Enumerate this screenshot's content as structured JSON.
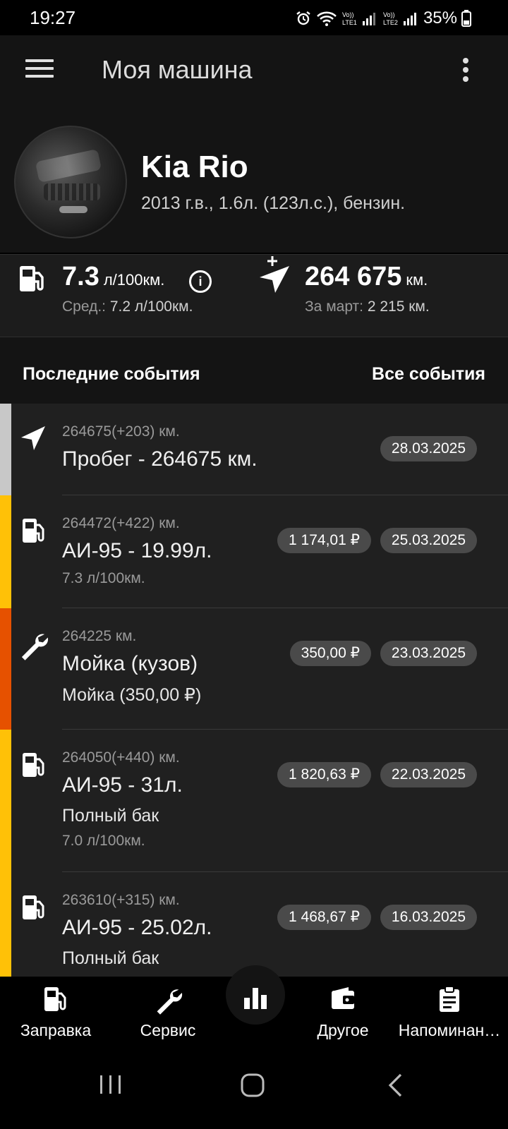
{
  "status": {
    "time": "19:27",
    "battery_pct": "35%",
    "icons": [
      "alarm-icon",
      "wifi-icon",
      "lte1-signal-icon",
      "lte2-signal-icon",
      "battery-icon"
    ]
  },
  "appbar": {
    "title": "Моя машина"
  },
  "car": {
    "name": "Kia Rio",
    "description": "2013 г.в., 1.6л. (123л.с.), бензин."
  },
  "stats": {
    "consumption": {
      "value": "7.3",
      "unit": "л/100км.",
      "avg_label": "Сред.: ",
      "avg_value": "7.2 л/100км."
    },
    "mileage": {
      "value": "264 675",
      "unit": "км.",
      "period_label": "За март: ",
      "period_value": "2 215 км."
    }
  },
  "section": {
    "title": "Последние события",
    "all_link": "Все события"
  },
  "events": [
    {
      "type": "mileage",
      "color": "#c8c8c8",
      "icon": "navigation-arrow-icon",
      "odo": "264675(+203) км.",
      "name": "Пробег - 264675 км.",
      "extra": "",
      "small": "",
      "price": "",
      "date": "28.03.2025"
    },
    {
      "type": "fuel",
      "color": "#ffc107",
      "icon": "fuel-pump-icon",
      "odo": "264472(+422) км.",
      "name": "АИ-95 - 19.99л.",
      "extra": "",
      "small": "7.3 л/100км.",
      "price": "1 174,01 ₽",
      "date": "25.03.2025"
    },
    {
      "type": "service",
      "color": "#e65100",
      "icon": "wrench-icon",
      "odo": "264225 км.",
      "name": "Мойка (кузов)",
      "extra": "Мойка (350,00 ₽)",
      "small": "",
      "price": "350,00 ₽",
      "date": "23.03.2025"
    },
    {
      "type": "fuel",
      "color": "#ffc107",
      "icon": "fuel-pump-icon",
      "odo": "264050(+440) км.",
      "name": "АИ-95 - 31л.",
      "extra": "Полный бак",
      "small": "7.0 л/100км.",
      "price": "1 820,63 ₽",
      "date": "22.03.2025"
    },
    {
      "type": "fuel",
      "color": "#ffc107",
      "icon": "fuel-pump-icon",
      "odo": "263610(+315) км.",
      "name": "АИ-95 - 25.02л.",
      "extra": "Полный бак",
      "small": "",
      "price": "1 468,67 ₽",
      "date": "16.03.2025"
    }
  ],
  "bottomnav": {
    "items": [
      {
        "label": "Заправка",
        "icon": "fuel-pump-icon"
      },
      {
        "label": "Сервис",
        "icon": "wrench-icon"
      },
      {
        "label": "Другое",
        "icon": "wallet-icon"
      },
      {
        "label": "Напоминан…",
        "icon": "clipboard-icon"
      }
    ],
    "fab_icon": "bar-chart-icon"
  },
  "colors": {
    "fuel": "#ffc107",
    "service": "#e65100",
    "mileage": "#c8c8c8",
    "chip": "#4a4a4a"
  }
}
